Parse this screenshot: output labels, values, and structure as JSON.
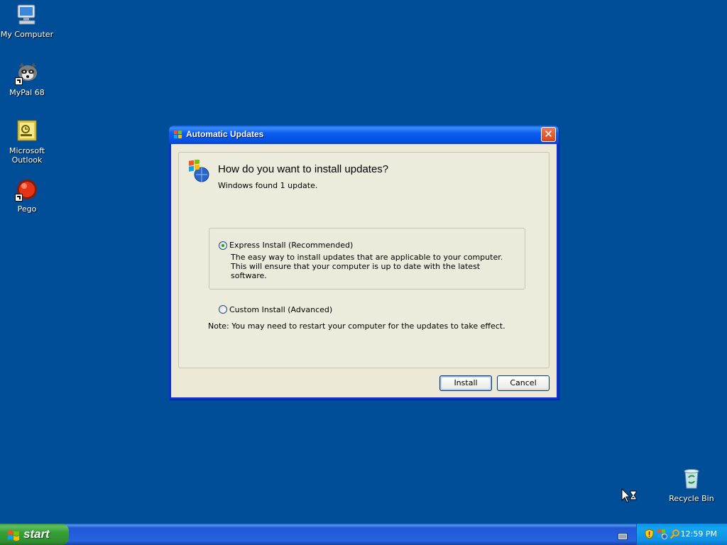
{
  "desktop": {
    "icons": [
      {
        "label": "My Computer"
      },
      {
        "label": "MyPal 68"
      },
      {
        "label": "Microsoft Outlook"
      },
      {
        "label": "Pego"
      },
      {
        "label": "Recycle Bin"
      }
    ]
  },
  "dialog": {
    "title": "Automatic Updates",
    "close_label": "✕",
    "heading": "How do you want to install updates?",
    "subtext": "Windows found 1 update.",
    "options": [
      {
        "label": "Express Install (Recommended)",
        "description": "The easy way to install updates that are applicable to your computer. This will ensure that your computer is up to date with the latest software.",
        "selected": true
      },
      {
        "label": "Custom Install (Advanced)",
        "selected": false
      }
    ],
    "note": "Note:  You may need to restart your computer for the updates to take effect.",
    "buttons": {
      "install": "Install",
      "cancel": "Cancel"
    }
  },
  "taskbar": {
    "start_label": "start",
    "clock": "12:59 PM",
    "tray_icons": [
      "security-shield-icon",
      "windows-update-icon",
      "search-icon"
    ],
    "colors": {
      "desktop_bg": "#004e98",
      "start_green": "#37a137",
      "taskbar_blue": "#2157d7"
    }
  }
}
